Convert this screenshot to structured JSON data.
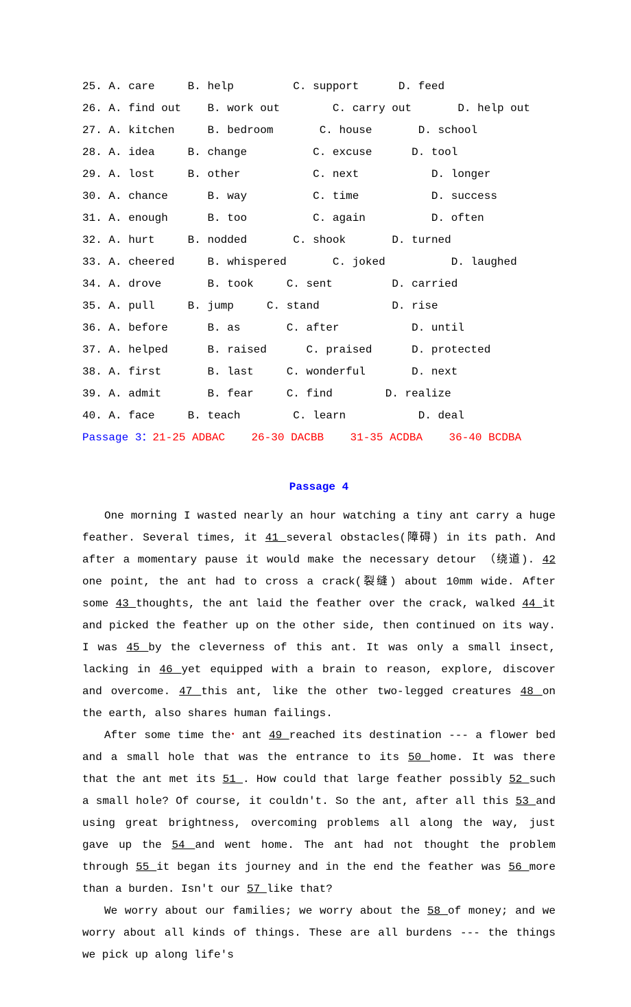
{
  "options": {
    "q25": {
      "num": "25.",
      "A": "A. care",
      "B": "B. help",
      "C": "C. support",
      "D": "D. feed"
    },
    "q26": {
      "num": "26.",
      "A": "A. find out",
      "B": "B. work out",
      "C": "C. carry out",
      "D": "D. help out"
    },
    "q27": {
      "num": "27.",
      "A": "A. kitchen",
      "B": "B. bedroom",
      "C": "C. house",
      "D": "D. school"
    },
    "q28": {
      "num": "28.",
      "A": "A. idea",
      "B": "B. change",
      "C": "C. excuse",
      "D": "D. tool"
    },
    "q29": {
      "num": "29.",
      "A": "A. lost",
      "B": "B. other",
      "C": "C. next",
      "D": "D. longer"
    },
    "q30": {
      "num": "30.",
      "A": "A. chance",
      "B": "B. way",
      "C": "C. time",
      "D": "D. success"
    },
    "q31": {
      "num": "31.",
      "A": "A. enough",
      "B": "B. too",
      "C": "C. again",
      "D": "D. often"
    },
    "q32": {
      "num": "32.",
      "A": "A. hurt",
      "B": "B. nodded",
      "C": "C. shook",
      "D": "D. turned"
    },
    "q33": {
      "num": "33.",
      "A": "A. cheered",
      "B": "B. whispered",
      "C": "C. joked",
      "D": "D. laughed"
    },
    "q34": {
      "num": "34.",
      "A": "A. drove",
      "B": "B. took",
      "C": "C. sent",
      "D": "D. carried"
    },
    "q35": {
      "num": "35.",
      "A": "A. pull",
      "B": "B. jump",
      "C": "C. stand",
      "D": "D. rise"
    },
    "q36": {
      "num": "36.",
      "A": "A. before",
      "B": "B. as",
      "C": "C. after",
      "D": "D. until"
    },
    "q37": {
      "num": "37.",
      "A": "A. helped",
      "B": "B. raised",
      "C": "C. praised",
      "D": "D. protected"
    },
    "q38": {
      "num": "38.",
      "A": "A. first",
      "B": "B. last",
      "C": "C. wonderful",
      "D": "D. next"
    },
    "q39": {
      "num": "39.",
      "A": "A. admit",
      "B": "B. fear",
      "C": "C. find",
      "D": "D. realize"
    },
    "q40": {
      "num": "40.",
      "A": "A. face",
      "B": "B. teach",
      "C": "C. learn",
      "D": "D. deal"
    }
  },
  "answer_key": {
    "label": "Passage 3：",
    "g1": "21-25 ADBAC",
    "g2": "26-30 DACBB",
    "g3": "31-35 ACDBA",
    "g4": "36-40 BCDBA"
  },
  "passage4": {
    "title": "Passage 4",
    "para1_pre": "One morning I wasted nearly an hour watching a tiny ant carry a huge feather. Several times, it ",
    "b41": " 41 ",
    "t1": " several obstacles(障碍) in its path. And after a momentary pause it would make the necessary detour （绕道). ",
    "b42": " 42 ",
    "t2": " one point, the ant had to cross a crack(裂缝) about 10mm wide. After some ",
    "b43": " 43 ",
    "t3": " thoughts, the ant laid the feather over the crack, walked ",
    "b44": " 44 ",
    "t4": " it and picked the feather up on the other side, then continued on its way. I was ",
    "b45": " 45 ",
    "t5": " by the cleverness of this ant. It was only a small insect, lacking in ",
    "b46": " 46 ",
    "t6": " yet equipped with a brain to reason, explore, discover and overcome. ",
    "b47": " 47  ",
    "t7": " this ant, like the other two-legged creatures ",
    "b48": " 48  ",
    "t8": "on the earth, also shares human failings.",
    "para2_pre": "After some time the",
    "marker": "•",
    "p2_t1": " ant ",
    "b49": " 49 ",
    "p2_t2": " reached its destination --- a flower bed and a small hole that was the entrance to its ",
    "b50": " 50 ",
    "p2_t3": " home. It was there that the ant met its ",
    "b51": " 51 ",
    "p2_t4": ". How could that large feather possibly ",
    "b52": " 52 ",
    "p2_t5": " such a small hole? Of course, it couldn't. So the ant, after all this ",
    "b53": " 53 ",
    "p2_t6": " and using great brightness, overcoming problems all along the way, just gave up the ",
    "b54": " 54 ",
    "p2_t7": " and went home. The ant had not thought the problem through   ",
    "b55": " 55 ",
    "p2_t8": " it began its journey and in the end the feather was ",
    "b56": " 56 ",
    "p2_t9": " more than a burden. Isn't our ",
    "b57": " 57 ",
    "p2_t10": " like that?",
    "para3_pre": "We worry about our families; we worry about the ",
    "b58": " 58 ",
    "p3_t1": " of money; and we worry about all kinds of things. These are all burdens --- the things we pick up along life's"
  }
}
